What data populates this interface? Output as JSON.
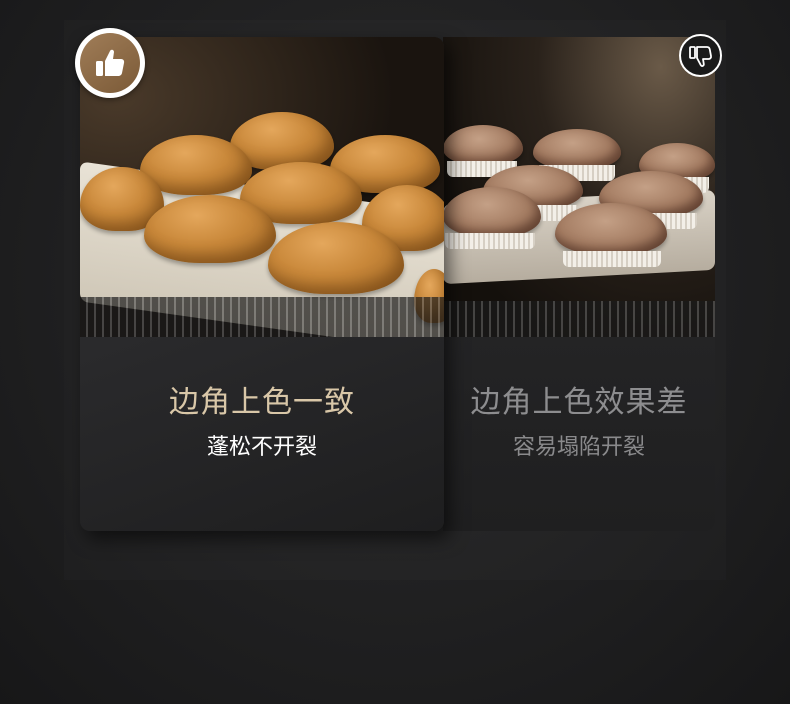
{
  "good": {
    "title": "边角上色一致",
    "subtitle": "蓬松不开裂",
    "badge_icon": "thumbs-up-icon"
  },
  "bad": {
    "title": "边角上色效果差",
    "subtitle": "容易塌陷开裂",
    "badge_icon": "thumbs-down-icon"
  },
  "colors": {
    "accent_gold": "#d9c7a8",
    "badge_brown": "#8b6a45"
  }
}
